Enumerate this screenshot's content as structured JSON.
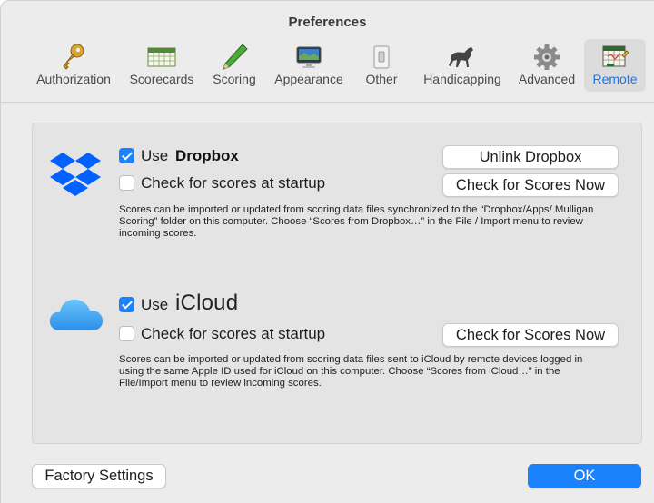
{
  "window": {
    "title": "Preferences"
  },
  "toolbar": {
    "items": [
      {
        "label": "Authorization",
        "icon": "key-icon"
      },
      {
        "label": "Scorecards",
        "icon": "scorecard-icon"
      },
      {
        "label": "Scoring",
        "icon": "pencil-icon"
      },
      {
        "label": "Appearance",
        "icon": "monitor-icon"
      },
      {
        "label": "Other",
        "icon": "switch-icon"
      },
      {
        "label": "Handicapping",
        "icon": "horse-icon"
      },
      {
        "label": "Advanced",
        "icon": "gear-icon"
      },
      {
        "label": "Remote",
        "icon": "remote-scorecard-icon",
        "selected": true
      }
    ]
  },
  "dropbox": {
    "use_label": "Use",
    "brand": "Dropbox",
    "use_checked": true,
    "startup_label": "Check for scores at startup",
    "startup_checked": false,
    "unlink_button": "Unlink Dropbox",
    "check_button": "Check for Scores Now",
    "description": "Scores can be imported or updated from scoring data files synchronized to the “Dropbox/Apps/ Mulligan Scoring” folder on this computer.  Choose “Scores from Dropbox…” in the File / Import menu to review incoming scores."
  },
  "icloud": {
    "use_label": "Use",
    "brand": "iCloud",
    "use_checked": true,
    "startup_label": "Check for scores at startup",
    "startup_checked": false,
    "check_button": "Check for Scores Now",
    "description": "Scores can be imported or updated from scoring data files sent to iCloud by remote devices logged in using the same Apple ID used for iCloud on this computer.  Choose “Scores from iCloud…” in the File/Import menu to review incoming scores."
  },
  "footer": {
    "factory_button": "Factory Settings",
    "ok_button": "OK"
  },
  "colors": {
    "accent": "#1a82fb",
    "dropbox": "#0061fe",
    "icloud": "#3aa0f0"
  }
}
